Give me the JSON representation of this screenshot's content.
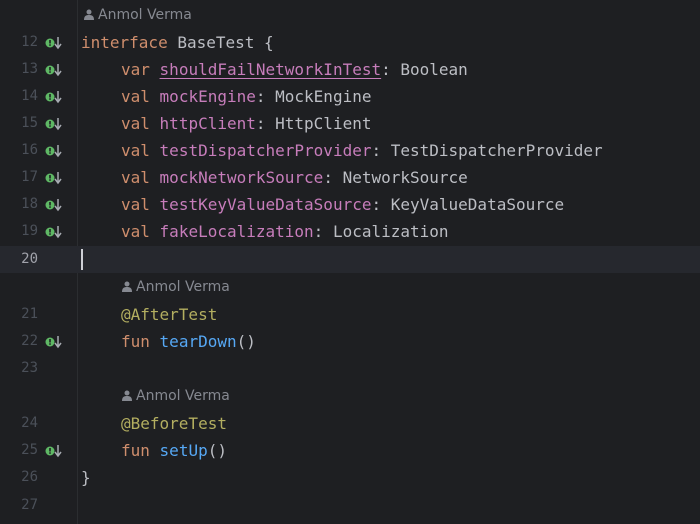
{
  "editor": {
    "author_name": "Anmol Verma",
    "lines": {
      "12": {
        "number": "12",
        "kw": "interface",
        "name": " BaseTest",
        "rest": " {"
      },
      "13": {
        "number": "13",
        "kw": "var",
        "prop": "shouldFailNetworkInTest",
        "type": ": Boolean"
      },
      "14": {
        "number": "14",
        "kw": "val",
        "prop": "mockEngine",
        "type": ": MockEngine"
      },
      "15": {
        "number": "15",
        "kw": "val",
        "prop": "httpClient",
        "type": ": HttpClient"
      },
      "16": {
        "number": "16",
        "kw": "val",
        "prop": "testDispatcherProvider",
        "type": ": TestDispatcherProvider"
      },
      "17": {
        "number": "17",
        "kw": "val",
        "prop": "mockNetworkSource",
        "type": ": NetworkSource"
      },
      "18": {
        "number": "18",
        "kw": "val",
        "prop": "testKeyValueDataSource",
        "type": ": KeyValueDataSource"
      },
      "19": {
        "number": "19",
        "kw": "val",
        "prop": "fakeLocalization",
        "type": ": Localization"
      },
      "20": {
        "number": "20"
      },
      "21": {
        "number": "21",
        "anno": "@AfterTest"
      },
      "22": {
        "number": "22",
        "kw": "fun",
        "fn": "tearDown",
        "rest": "()"
      },
      "23": {
        "number": "23"
      },
      "24": {
        "number": "24",
        "anno": "@BeforeTest"
      },
      "25": {
        "number": "25",
        "kw": "fun",
        "fn": "setUp",
        "rest": "()"
      },
      "26": {
        "number": "26",
        "rest": "}"
      },
      "27": {
        "number": "27"
      }
    },
    "current_line": "20"
  },
  "icons": {
    "gutter_marker": "implemented-in-subclass-icon",
    "author": "person-icon"
  },
  "colors": {
    "background": "#1e1f22",
    "current_line": "#26282e",
    "keyword": "#cf8e6d",
    "property": "#c77dbb",
    "annotation": "#b3ae60",
    "function": "#56a8f5",
    "text": "#bcbec4",
    "line_number": "#4b5059",
    "marker_green": "#5fb865"
  }
}
